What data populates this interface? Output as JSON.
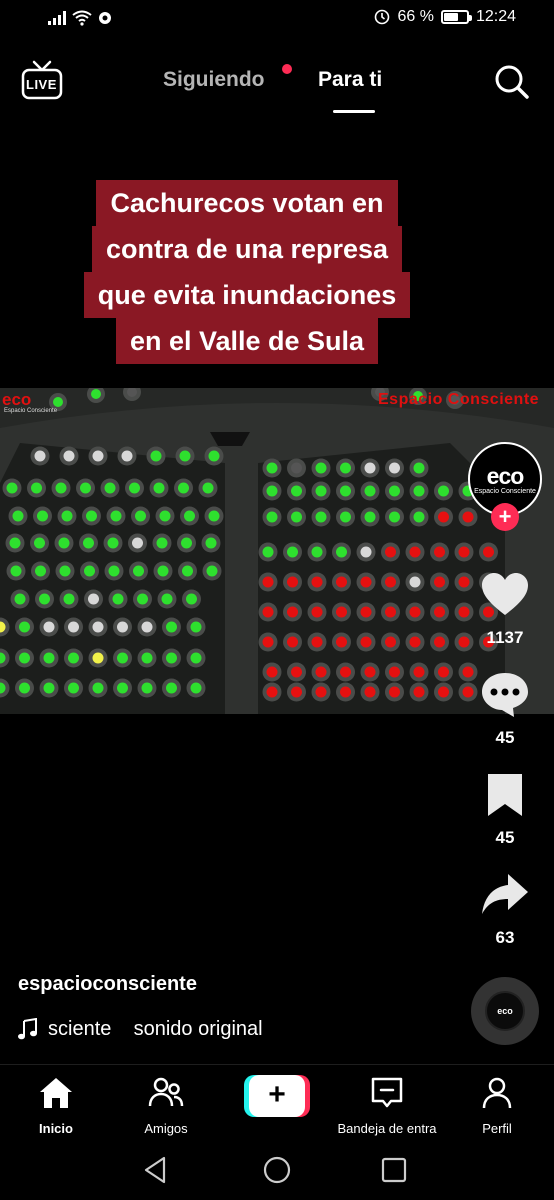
{
  "status_bar": {
    "battery_text": "66 %",
    "battery_level": 0.66,
    "time": "12:24"
  },
  "top_nav": {
    "live_label": "LIVE",
    "tabs": [
      {
        "label": "Siguiendo",
        "active": false,
        "has_dot": true
      },
      {
        "label": "Para ti",
        "active": true
      }
    ]
  },
  "video": {
    "caption_lines": [
      "Cachurecos votan en",
      "contra de una represa",
      "que evita inundaciones",
      "en el Valle de Sula"
    ],
    "watermark_left": "eco",
    "watermark_left_sub": "Espacio Consciente",
    "watermark_right": "Espacio Consciente"
  },
  "actions": {
    "avatar_text": "eco",
    "avatar_sub": "Espacio Consciente",
    "follow_label": "+",
    "likes": "1137",
    "comments": "45",
    "saves": "45",
    "shares": "63"
  },
  "post": {
    "username": "espacioconsciente",
    "sound_text": "sciente    sonido original",
    "disc_text": "eco"
  },
  "bottom_nav": {
    "create_label": "+",
    "items": [
      {
        "label": "Inicio",
        "icon": "home-icon",
        "active": true
      },
      {
        "label": "Amigos",
        "icon": "friends-icon",
        "active": false
      },
      {
        "label": "Bandeja de entra",
        "icon": "inbox-icon",
        "active": false
      },
      {
        "label": "Perfil",
        "icon": "profile-icon",
        "active": false
      }
    ]
  },
  "colors": {
    "accent_red": "#fe2c55",
    "accent_cyan": "#25f4ee",
    "caption_bg": "#8a1824",
    "vote_green": "#2ee02e",
    "vote_red": "#e61010"
  }
}
